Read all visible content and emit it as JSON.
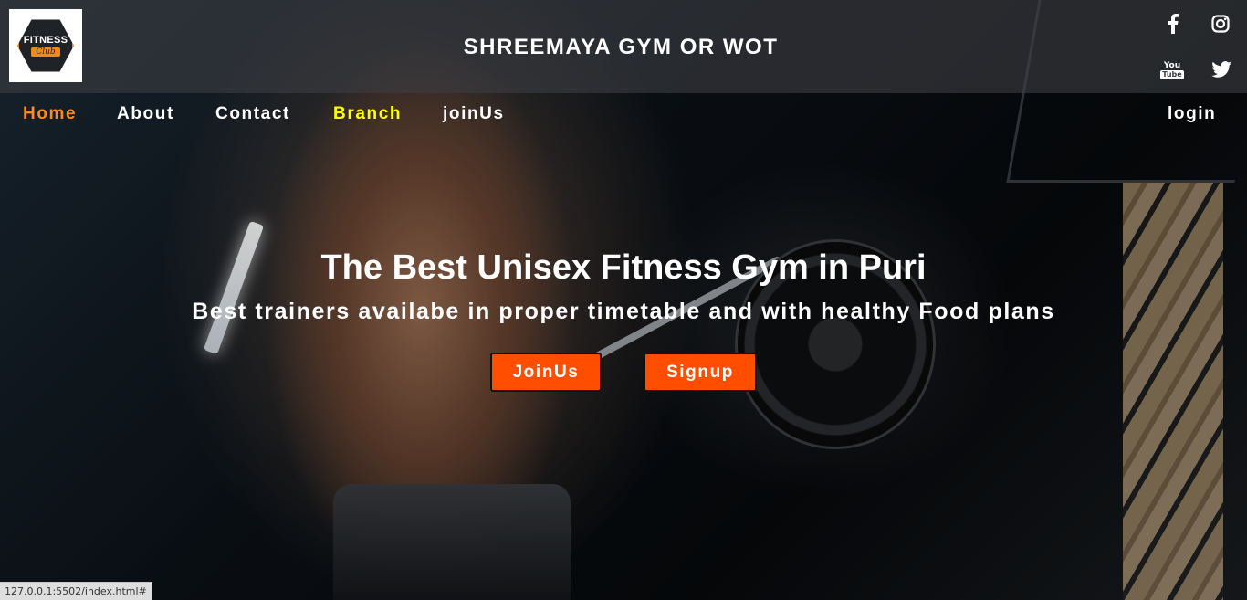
{
  "header": {
    "logo": {
      "main": "FITNESS",
      "sub": "Club"
    },
    "title": "SHREEMAYA GYM OR WOT"
  },
  "social": {
    "icons": [
      "facebook-icon",
      "instagram-icon",
      "youtube-icon",
      "twitter-icon"
    ],
    "youtube_label_top": "You",
    "youtube_label_bottom": "Tube"
  },
  "nav": {
    "items": [
      "Home",
      "About",
      "Contact",
      "Branch",
      "joinUs"
    ],
    "login": "login"
  },
  "hero": {
    "title": "The Best Unisex Fitness Gym in Puri",
    "subtitle": "Best trainers availabe in proper timetable and with healthy Food plans",
    "buttons": [
      "JoinUs",
      "Signup"
    ]
  },
  "colors": {
    "accent": "#ff4e00",
    "nav_active": "#ff8a1e",
    "nav_highlight": "#ffff00"
  },
  "status": {
    "url": "127.0.0.1:5502/index.html#"
  }
}
